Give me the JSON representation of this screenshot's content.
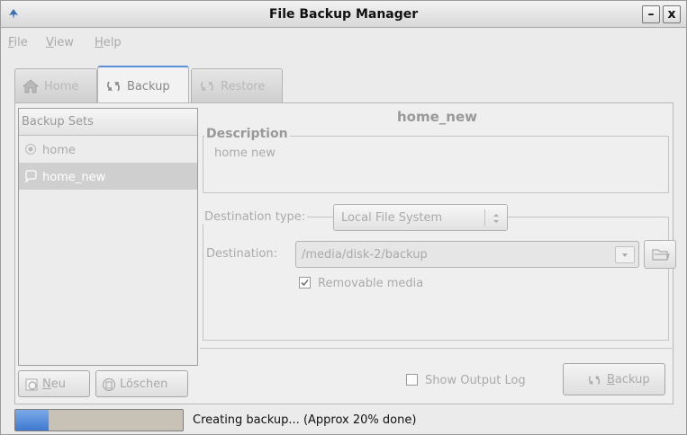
{
  "window": {
    "title": "File Backup Manager",
    "minimize_label": "–",
    "close_label": "x"
  },
  "menu": {
    "items": [
      {
        "accel": "F",
        "rest": "ile"
      },
      {
        "accel": "V",
        "rest": "iew"
      },
      {
        "accel": "H",
        "rest": "elp"
      }
    ]
  },
  "tabs": [
    {
      "label": "Home",
      "icon": "home-icon",
      "active": false
    },
    {
      "label": "Backup",
      "icon": "backup-icon",
      "active": true
    },
    {
      "label": "Restore",
      "icon": "restore-icon",
      "active": false
    }
  ],
  "sets": {
    "header": "Backup Sets",
    "items": [
      {
        "label": "home",
        "icon": "radio-dot-icon",
        "selected": false
      },
      {
        "label": "home_new",
        "icon": "speech-bubble-icon",
        "selected": true
      }
    ],
    "new_accel": "N",
    "new_rest": "eu",
    "delete_label": "Löschen"
  },
  "detail": {
    "set_name": "home_new",
    "description_label": "Description",
    "description_text": "home new",
    "destination_type_label": "Destination type:",
    "destination_type_value": "Local File System",
    "destination_label": "Destination:",
    "destination_value": "/media/disk-2/backup",
    "removable_media_label": "Removable media",
    "removable_media_checked": true
  },
  "actions": {
    "show_output_log_label": "Show Output Log",
    "show_output_log_checked": false,
    "backup_accel": "B",
    "backup_rest": "ackup"
  },
  "status": {
    "progress_fraction": 0.2,
    "text": "Creating backup... (Approx 20% done)"
  },
  "colors": {
    "progress_fill": "#3e79d0",
    "tab_accent": "#5b8fd6"
  }
}
